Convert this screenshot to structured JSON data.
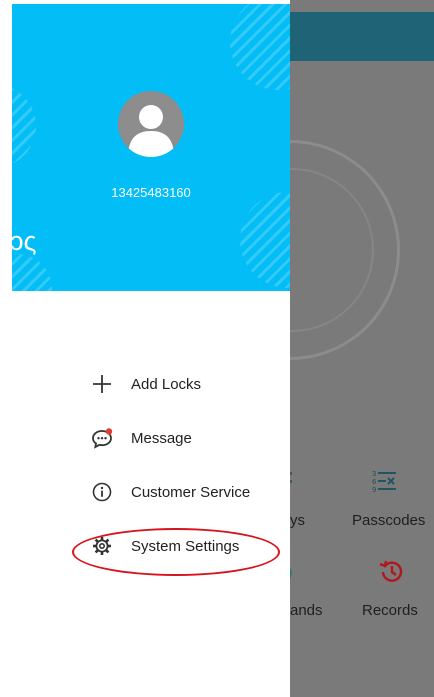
{
  "user": {
    "phone": "13425483160",
    "edge_text": "ɔς"
  },
  "menu": {
    "items": [
      {
        "id": "add-locks",
        "label": "Add Locks",
        "icon": "plus-icon"
      },
      {
        "id": "message",
        "label": "Message",
        "icon": "message-bubble-icon"
      },
      {
        "id": "customer-service",
        "label": "Customer Service",
        "icon": "info-circle-icon"
      },
      {
        "id": "system-settings",
        "label": "System Settings",
        "icon": "gear-icon"
      }
    ]
  },
  "background_app": {
    "tiles": [
      {
        "label": "ys",
        "icon": "keys-icon"
      },
      {
        "label": "Passcodes",
        "icon": "passcodes-icon"
      },
      {
        "label": "ands",
        "icon": "commands-icon"
      },
      {
        "label": "Records",
        "icon": "history-icon"
      }
    ]
  },
  "colors": {
    "header": "#02bdf6",
    "overlay": "#7a7a7a",
    "topbar": "#1f6376",
    "accent_red": "#d6141c",
    "badge_red": "#e53935"
  }
}
